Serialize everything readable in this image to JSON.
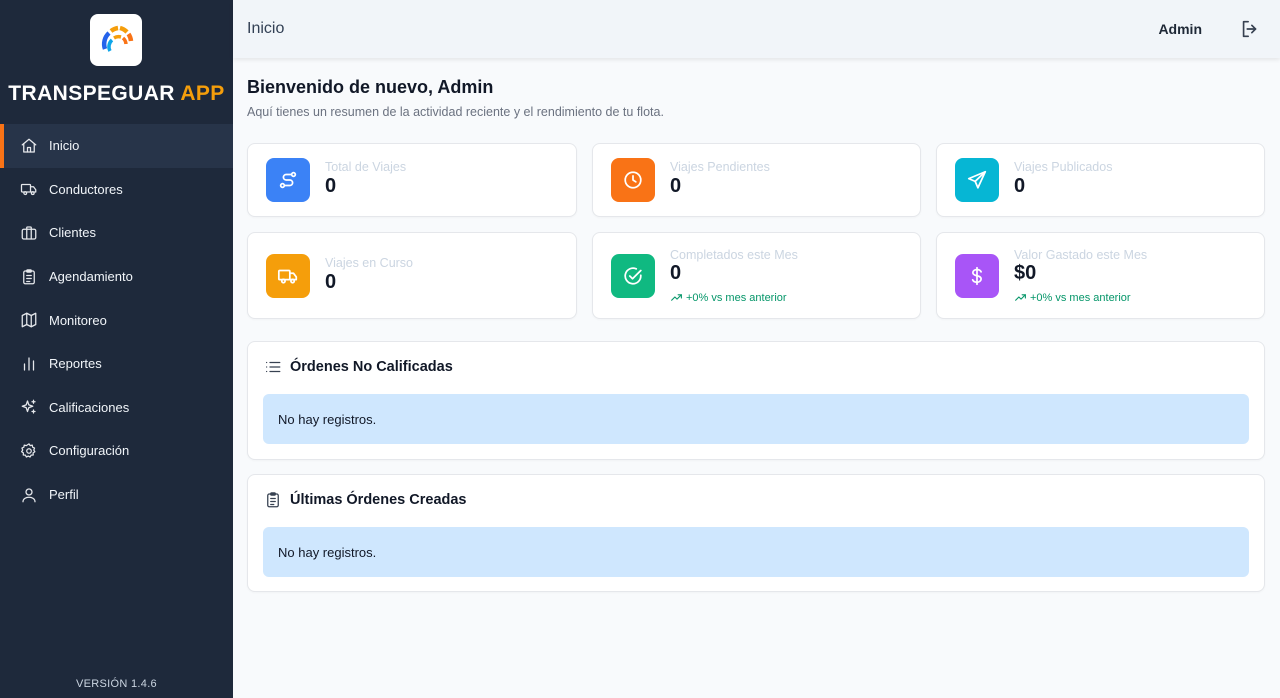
{
  "app": {
    "brand_main": "TRANSPEGUAR",
    "brand_accent": "APP",
    "version": "VERSIÓN 1.4.6",
    "accent_color": "#f97316"
  },
  "sidebar": {
    "items": [
      {
        "label": "Inicio",
        "icon": "home-icon",
        "active": true
      },
      {
        "label": "Conductores",
        "icon": "truck-icon"
      },
      {
        "label": "Clientes",
        "icon": "briefcase-icon"
      },
      {
        "label": "Agendamiento",
        "icon": "clipboard-icon"
      },
      {
        "label": "Monitoreo",
        "icon": "map-icon"
      },
      {
        "label": "Reportes",
        "icon": "bar-chart-icon"
      },
      {
        "label": "Calificaciones",
        "icon": "sparkles-icon"
      },
      {
        "label": "Configuración",
        "icon": "gear-icon"
      },
      {
        "label": "Perfil",
        "icon": "user-icon"
      }
    ]
  },
  "header": {
    "title": "Inicio",
    "user": "Admin",
    "logout_icon": "logout-icon"
  },
  "main": {
    "welcome": "Bienvenido de nuevo, Admin",
    "subtitle": "Aquí tienes un resumen de la actividad reciente y el rendimiento de tu flota.",
    "stats": [
      {
        "label": "Total de Viajes",
        "value": "0",
        "icon": "route-icon",
        "color": "#3b82f6"
      },
      {
        "label": "Viajes Pendientes",
        "value": "0",
        "icon": "clock-icon",
        "color": "#f97316"
      },
      {
        "label": "Viajes Publicados",
        "value": "0",
        "icon": "send-icon",
        "color": "#06b6d4"
      },
      {
        "label": "Viajes en Curso",
        "value": "0",
        "icon": "truck-icon",
        "color": "#f59e0b"
      },
      {
        "label": "Completados este Mes",
        "value": "0",
        "icon": "check-circle-icon",
        "color": "#10b981",
        "trend": "+0% vs mes anterior"
      },
      {
        "label": "Valor Gastado este Mes",
        "value": "$0",
        "icon": "dollar-icon",
        "color": "#a855f7",
        "trend": "+0% vs mes anterior"
      }
    ],
    "panels": [
      {
        "title": "Órdenes No Calificadas",
        "icon": "list-icon",
        "empty": "No hay registros."
      },
      {
        "title": "Últimas Órdenes Creadas",
        "icon": "clipboard-icon",
        "empty": "No hay registros."
      }
    ]
  }
}
